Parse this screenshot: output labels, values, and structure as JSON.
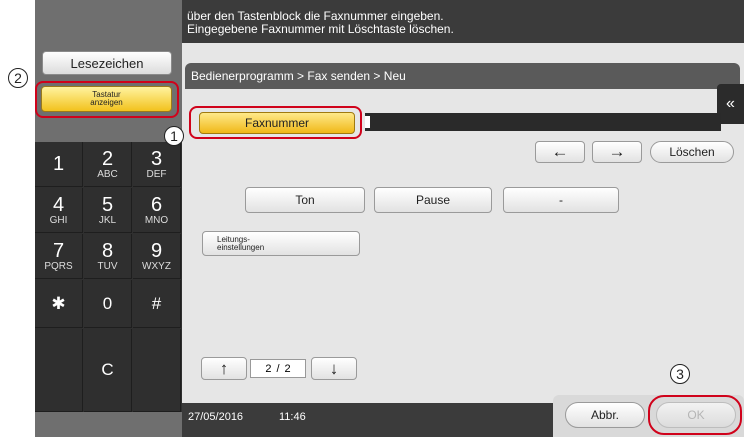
{
  "instructions": {
    "line1": "über den Tastenblock die Faxnummer eingeben.",
    "line2": "Eingegebene Faxnummer mit Löschtaste löschen."
  },
  "sidebar": {
    "bookmark_label": "Lesezeichen",
    "keyboard_line1": "Tastatur",
    "keyboard_line2": "anzeigen"
  },
  "keypad": {
    "keys": [
      {
        "num": "1",
        "letters": ""
      },
      {
        "num": "2",
        "letters": "ABC"
      },
      {
        "num": "3",
        "letters": "DEF"
      },
      {
        "num": "4",
        "letters": "GHI"
      },
      {
        "num": "5",
        "letters": "JKL"
      },
      {
        "num": "6",
        "letters": "MNO"
      },
      {
        "num": "7",
        "letters": "PQRS"
      },
      {
        "num": "8",
        "letters": "TUV"
      },
      {
        "num": "9",
        "letters": "WXYZ"
      },
      {
        "num": "✱",
        "letters": ""
      },
      {
        "num": "0",
        "letters": ""
      },
      {
        "num": "#",
        "letters": ""
      },
      {
        "num": "",
        "letters": ""
      },
      {
        "num": "C",
        "letters": ""
      },
      {
        "num": "",
        "letters": ""
      }
    ]
  },
  "breadcrumb": "Bedienerprogramm > Fax senden > Neu",
  "fax_number_label": "Faxnummer",
  "fax_number_value": "",
  "nav": {
    "left_arrow": "←",
    "right_arrow": "→",
    "delete_label": "Löschen"
  },
  "dial_buttons": {
    "tone": "Ton",
    "pause": "Pause",
    "dash": "-"
  },
  "line_settings": {
    "line1": "Leitungs-",
    "line2": "einstellungen"
  },
  "pager": {
    "up": "↑",
    "down": "↓",
    "current": "2",
    "separator": "/",
    "total": "2"
  },
  "status": {
    "date": "27/05/2016",
    "time": "11:46"
  },
  "actions": {
    "cancel_label": "Abbr.",
    "ok_label": "OK"
  },
  "callouts": {
    "one": "1",
    "two": "2",
    "three": "3"
  },
  "collapse_icon": "«",
  "colors": {
    "accent_yellow": "#f2c21d",
    "callout_red": "#d0021b",
    "panel_dark": "#2f2f2f"
  }
}
